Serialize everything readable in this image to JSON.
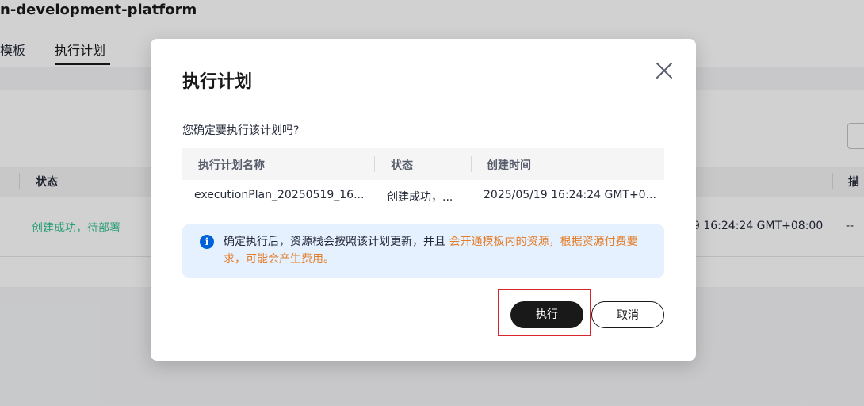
{
  "background": {
    "page_title": "n-development-platform",
    "tabs": [
      {
        "label": "模板"
      },
      {
        "label": "执行计划"
      }
    ],
    "table": {
      "headers": [
        "状态",
        "描"
      ],
      "row": {
        "status": "创建成功，待部署",
        "time": "9 16:24:24 GMT+08:00",
        "desc": "--"
      }
    },
    "search_stub": "i"
  },
  "dialog": {
    "title": "执行计划",
    "close_icon": "close-icon",
    "question": "您确定要执行该计划吗?",
    "table": {
      "headers": [
        "执行计划名称",
        "状态",
        "创建时间"
      ],
      "rows": [
        {
          "name": "executionPlan_20250519_16...",
          "status": "创建成功，...",
          "created": "2025/05/19 16:24:24 GMT+0..."
        }
      ]
    },
    "notice": {
      "icon": "info-icon",
      "text_prefix": "确定执行后，资源栈会按照该计划更新，并且 ",
      "text_warning": "会开通模板内的资源，根据资源付费要求，可能会产生费用。"
    },
    "buttons": {
      "execute": "执行",
      "cancel": "取消"
    },
    "colors": {
      "primary_button": "#191919",
      "notice_bg": "#e6f1ff",
      "info_icon": "#0062da",
      "warning_text": "#e37d29",
      "success_text": "#3ac295",
      "highlight_border": "#d9262c"
    }
  }
}
